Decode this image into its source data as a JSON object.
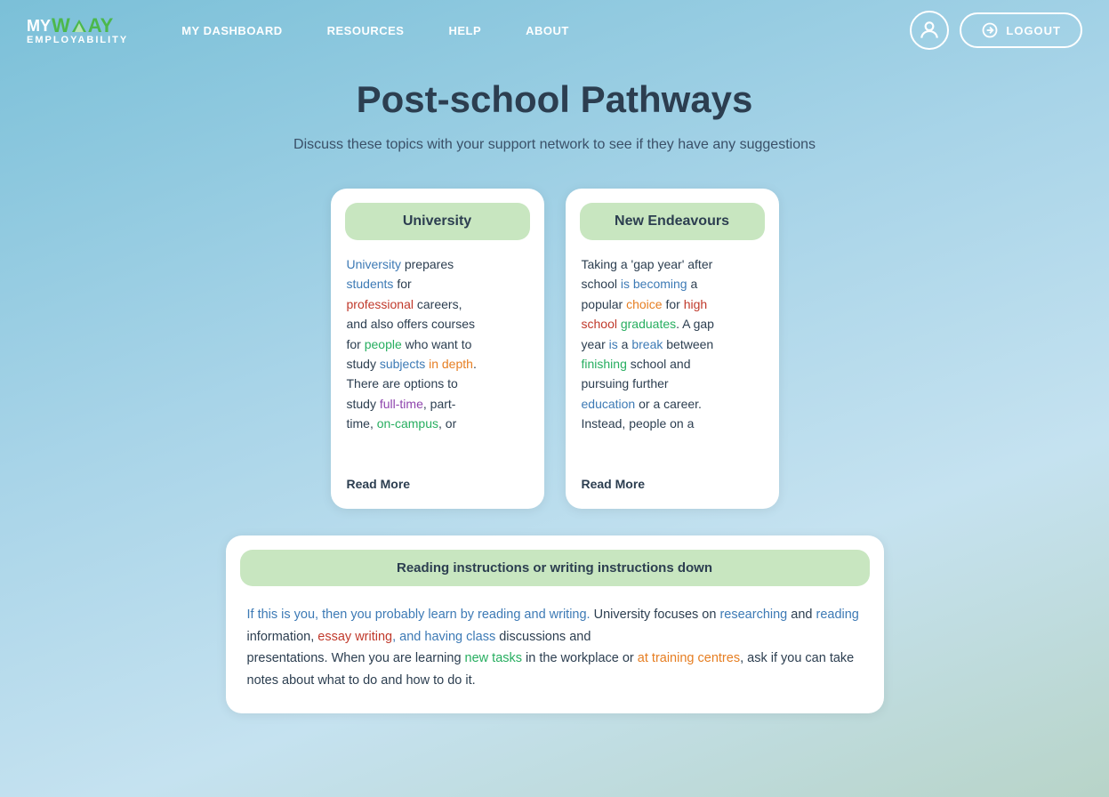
{
  "header": {
    "logo": {
      "my": "MY",
      "way": "WAY",
      "sub": "EMPLOYABILITY"
    },
    "nav": {
      "items": [
        {
          "label": "MY DASHBOARD",
          "id": "dashboard"
        },
        {
          "label": "RESOURCES",
          "id": "resources"
        },
        {
          "label": "HELP",
          "id": "help"
        },
        {
          "label": "ABOUT",
          "id": "about"
        }
      ]
    },
    "logout_label": "LOGOUT"
  },
  "main": {
    "title": "Post-school Pathways",
    "subtitle": "Discuss these topics with your support network to see if they have any suggestions",
    "cards": [
      {
        "id": "university",
        "title": "University",
        "body": "University prepares students for professional careers, and also offers courses for people who want to study subjects in depth. There are options to study full-time, part-time, on-campus, or",
        "read_more": "Read More"
      },
      {
        "id": "new-endeavours",
        "title": "New Endeavours",
        "body": "Taking a 'gap year' after school is becoming a popular choice for high school graduates. A gap year is a break between finishing school and pursuing further education or a career. Instead, people on a",
        "read_more": "Read More"
      }
    ],
    "bottom": {
      "title": "Reading instructions or writing instructions down",
      "body": "If this is you, then you probably learn by reading and writing. University focuses on researching and reading information, essay writing, and having class discussions and presentations. When you are learning new tasks in the workplace or at training centres, ask if you can take notes about what to do and how to do it."
    }
  }
}
